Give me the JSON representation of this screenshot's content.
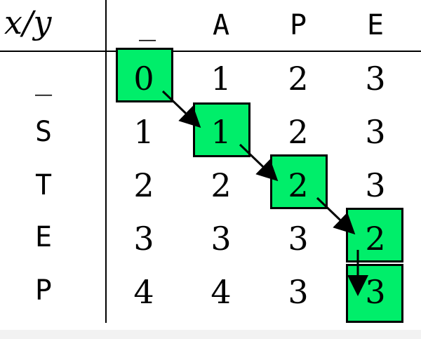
{
  "corner_label": "x/y",
  "column_headers": [
    "_",
    "A",
    "P",
    "E"
  ],
  "row_headers": [
    "_",
    "S",
    "T",
    "E",
    "P"
  ],
  "matrix": [
    [
      "0",
      "1",
      "2",
      "3"
    ],
    [
      "1",
      "1",
      "2",
      "3"
    ],
    [
      "2",
      "2",
      "2",
      "3"
    ],
    [
      "3",
      "3",
      "3",
      "2"
    ],
    [
      "4",
      "4",
      "3",
      "3"
    ]
  ],
  "highlight_path": [
    [
      0,
      0
    ],
    [
      1,
      1
    ],
    [
      2,
      2
    ],
    [
      3,
      3
    ],
    [
      4,
      3
    ]
  ],
  "colors": {
    "highlight": "#00ee6a",
    "grid": "#000000"
  }
}
